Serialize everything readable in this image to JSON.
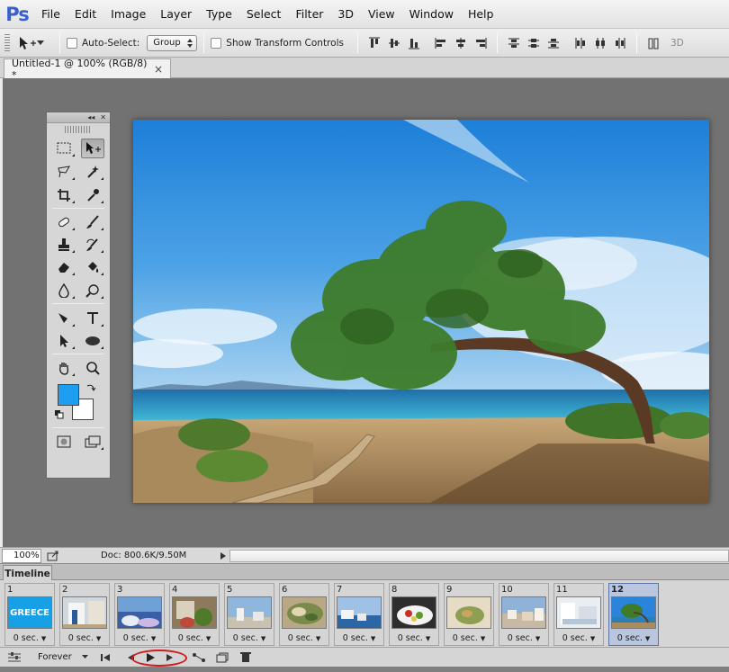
{
  "app": {
    "logo": "Ps"
  },
  "menu": [
    "File",
    "Edit",
    "Image",
    "Layer",
    "Type",
    "Select",
    "Filter",
    "3D",
    "View",
    "Window",
    "Help"
  ],
  "options": {
    "auto_select_label": "Auto-Select:",
    "auto_select_value": "Group",
    "show_transform_label": "Show Transform Controls",
    "trailing_label": "3D"
  },
  "document": {
    "tab_title": "Untitled-1 @ 100% (RGB/8) *",
    "close_glyph": "×"
  },
  "status": {
    "zoom": "100%",
    "doc_info": "Doc: 800.6K/9.50M"
  },
  "timeline": {
    "tab_label": "Timeline",
    "loop_value": "Forever",
    "frames": [
      {
        "num": "1",
        "delay": "0 sec.",
        "thumb_text": "GREECE"
      },
      {
        "num": "2",
        "delay": "0 sec.",
        "thumb_text": ""
      },
      {
        "num": "3",
        "delay": "0 sec.",
        "thumb_text": ""
      },
      {
        "num": "4",
        "delay": "0 sec.",
        "thumb_text": ""
      },
      {
        "num": "5",
        "delay": "0 sec.",
        "thumb_text": ""
      },
      {
        "num": "6",
        "delay": "0 sec.",
        "thumb_text": ""
      },
      {
        "num": "7",
        "delay": "0 sec.",
        "thumb_text": ""
      },
      {
        "num": "8",
        "delay": "0 sec.",
        "thumb_text": ""
      },
      {
        "num": "9",
        "delay": "0 sec.",
        "thumb_text": ""
      },
      {
        "num": "10",
        "delay": "0 sec.",
        "thumb_text": ""
      },
      {
        "num": "11",
        "delay": "0 sec.",
        "thumb_text": ""
      },
      {
        "num": "12",
        "delay": "0 sec.",
        "thumb_text": "",
        "selected": true
      }
    ]
  },
  "colors": {
    "foreground": "#1e9ef0",
    "background": "#ffffff",
    "annotation": "#cf1d1d"
  }
}
